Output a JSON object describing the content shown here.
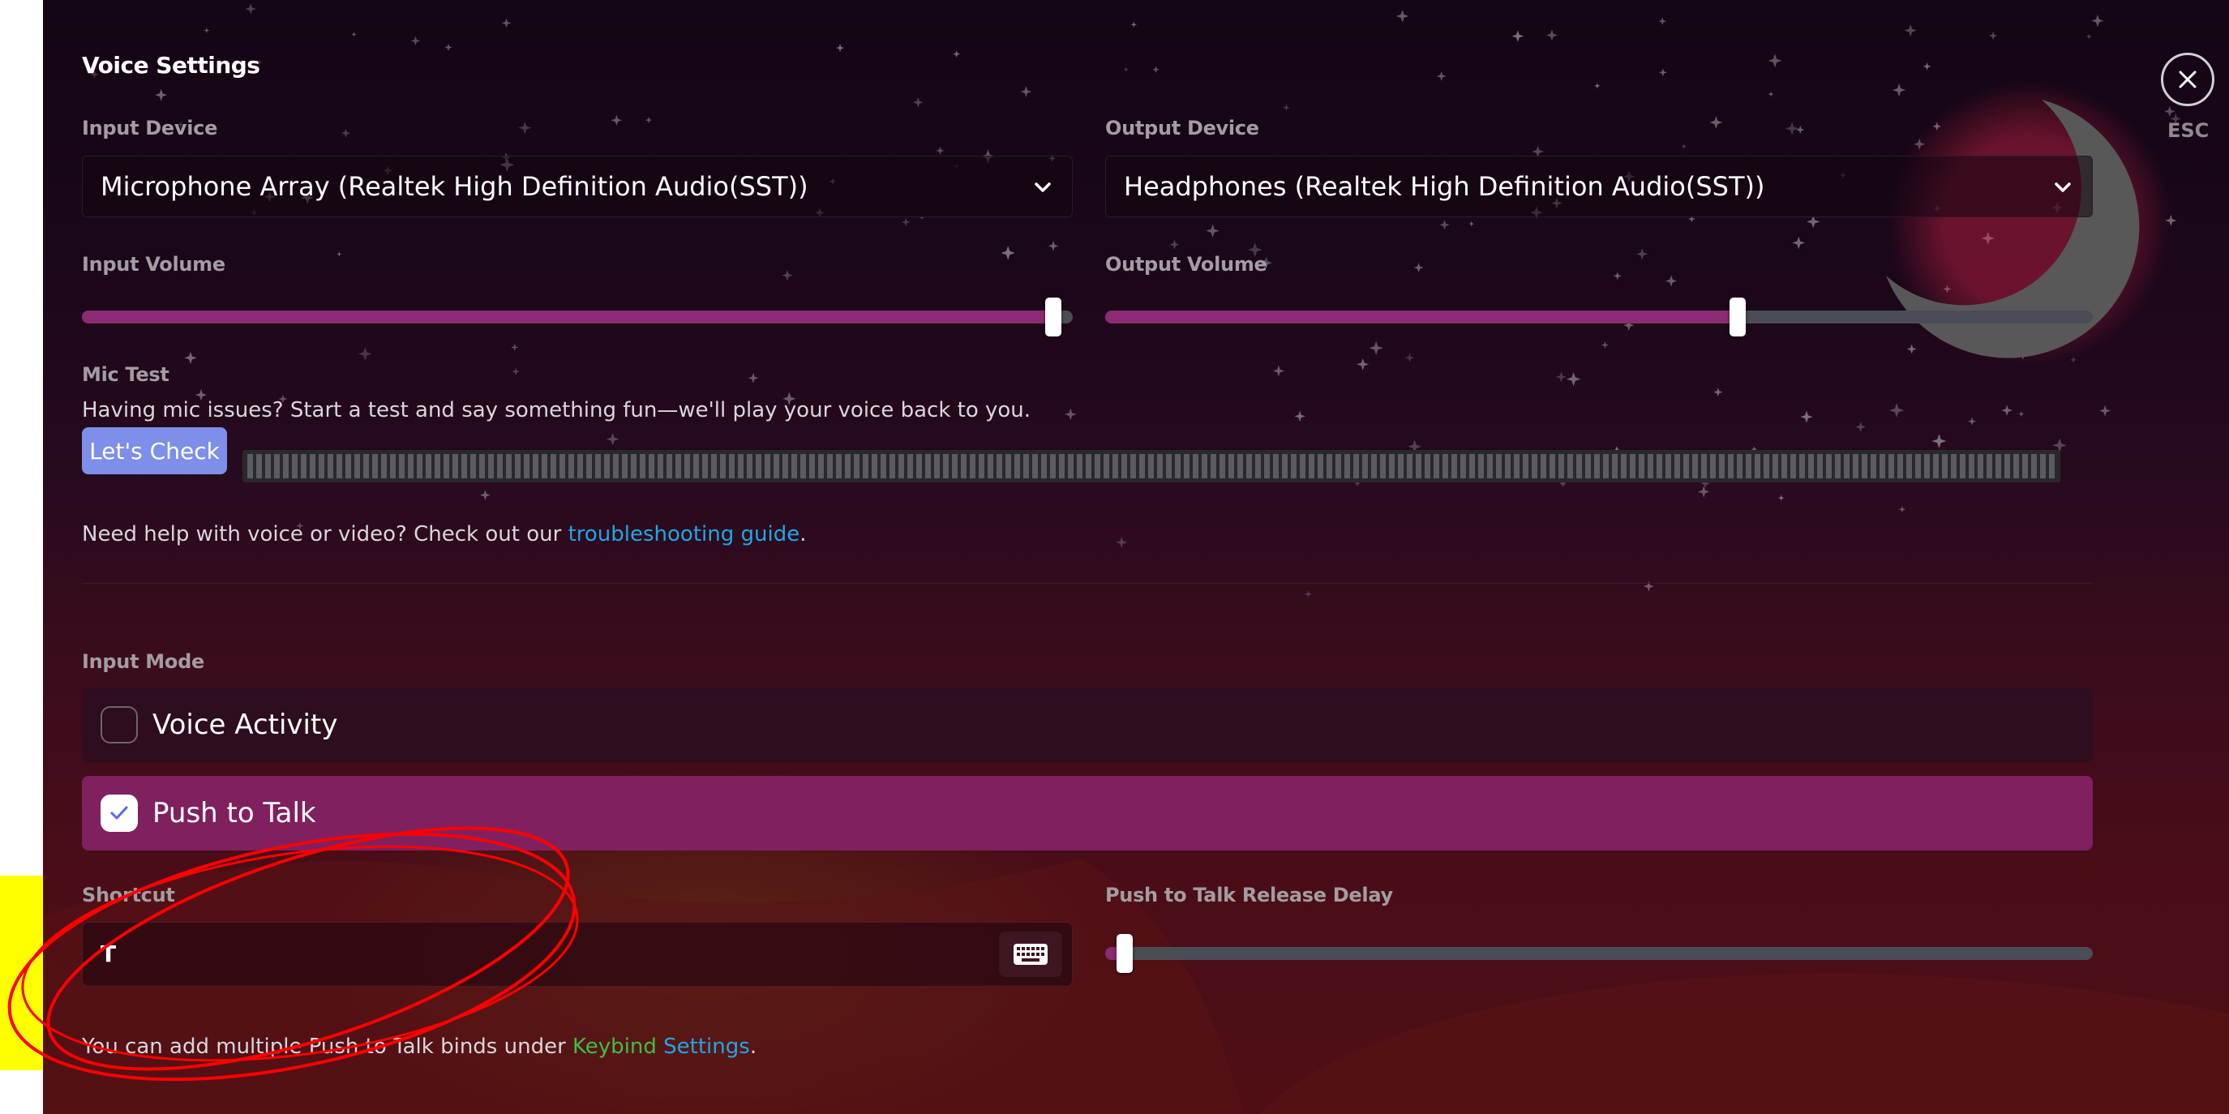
{
  "dialog": {
    "title": "Voice Settings",
    "close_label": "ESC"
  },
  "input_device": {
    "label": "Input Device",
    "value": "Microphone Array (Realtek High Definition Audio(SST))"
  },
  "output_device": {
    "label": "Output Device",
    "value": "Headphones (Realtek High Definition Audio(SST))"
  },
  "input_volume": {
    "label": "Input Volume",
    "value_percent": 98
  },
  "output_volume": {
    "label": "Output Volume",
    "value_percent": 64
  },
  "mic_test": {
    "label": "Mic Test",
    "description": "Having mic issues? Start a test and say something fun—we'll play your voice back to you.",
    "button_label": "Let's Check"
  },
  "help": {
    "prefix": "Need help with voice or video? Check out our ",
    "link_text": "troubleshooting guide",
    "suffix": "."
  },
  "input_mode": {
    "label": "Input Mode",
    "options": [
      {
        "label": "Voice Activity",
        "selected": false
      },
      {
        "label": "Push to Talk",
        "selected": true
      }
    ]
  },
  "shortcut": {
    "label": "Shortcut",
    "value": "T"
  },
  "ptt_release_delay": {
    "label": "Push to Talk Release Delay",
    "value_percent": 2
  },
  "footer": {
    "prefix": "You can add multiple Push to Talk binds under ",
    "link_text_1": "Keybind",
    "link_text_2": "Settings",
    "suffix": "."
  },
  "colors": {
    "accent": "#80205f",
    "slider_fill": "#8b2b73",
    "button": "#7d8fe8",
    "link": "#1fa7e6",
    "annotation": "#ff0000",
    "highlight": "#ffff00"
  },
  "icons": [
    "chevron-down-icon",
    "checkmark-icon",
    "keyboard-icon",
    "close-icon",
    "crescent-moon-icon"
  ]
}
